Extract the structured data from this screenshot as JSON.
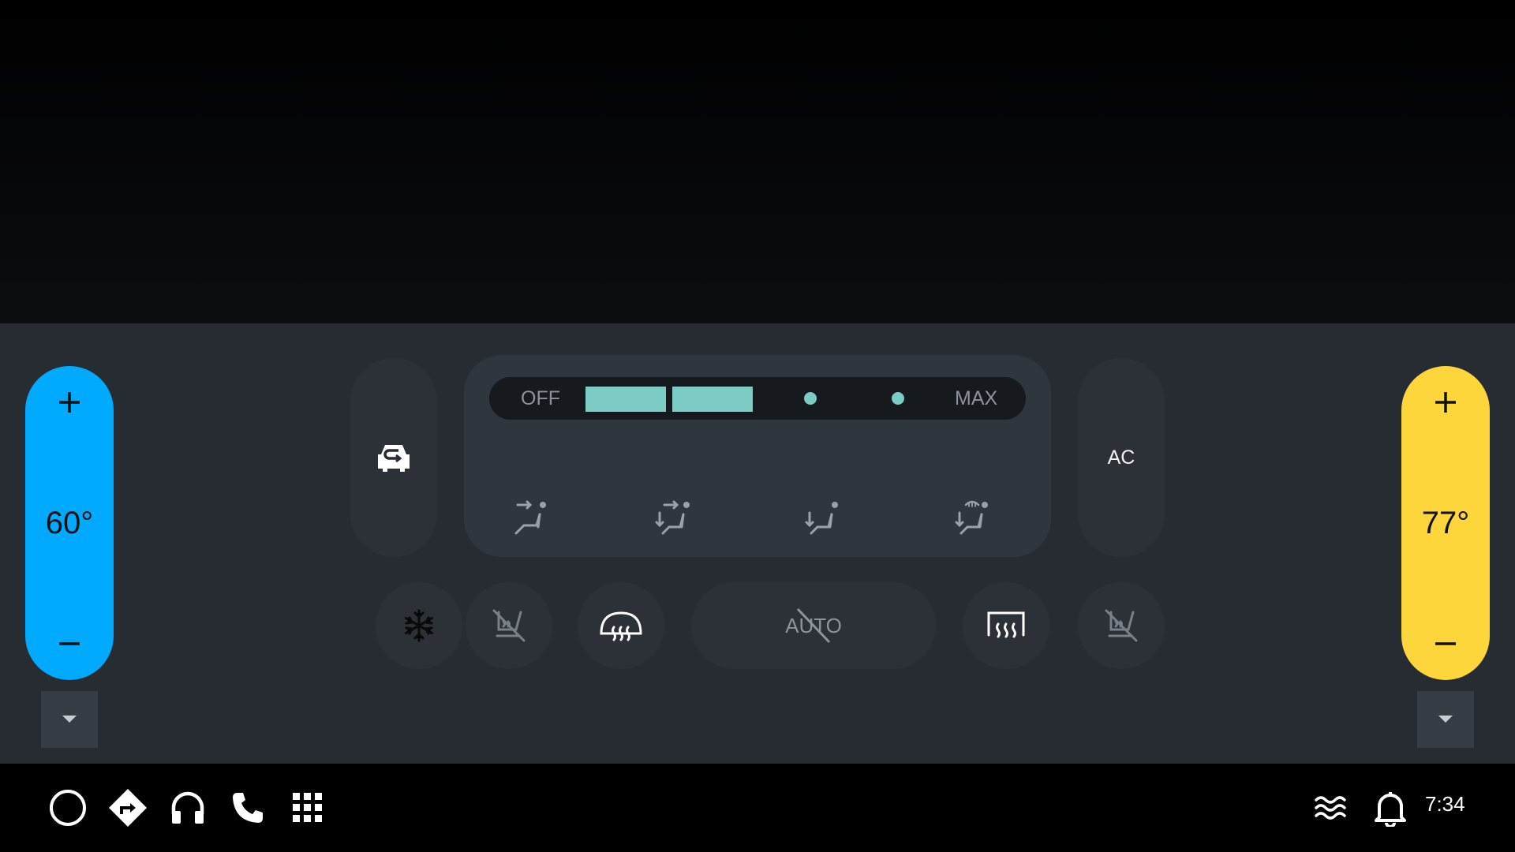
{
  "colors": {
    "driver_temp": "#00aaff",
    "passenger_temp": "#fdd63c",
    "fan_active": "#7ccbc4",
    "panel_bg": "#272c33"
  },
  "driver": {
    "temperature": "60°",
    "plus_label": "+",
    "minus_label": "−"
  },
  "passenger": {
    "temperature": "77°",
    "plus_label": "+",
    "minus_label": "−"
  },
  "fan": {
    "off_label": "OFF",
    "max_label": "MAX",
    "speed_level": 2,
    "speed_steps": 4
  },
  "controls": {
    "ac_label": "AC",
    "auto_label": "AUTO",
    "recirculation_icon": "car-recirculation-icon",
    "ac_max_icon": "snowflake-icon",
    "front_defrost_icon": "front-defrost-icon",
    "rear_defrost_icon": "rear-defrost-icon",
    "seat_heat_icon": "seat-heat-off-icon"
  },
  "airflow_modes": [
    "face",
    "face-and-floor",
    "floor",
    "floor-and-defrost"
  ],
  "status_bar": {
    "time": "7:34"
  }
}
